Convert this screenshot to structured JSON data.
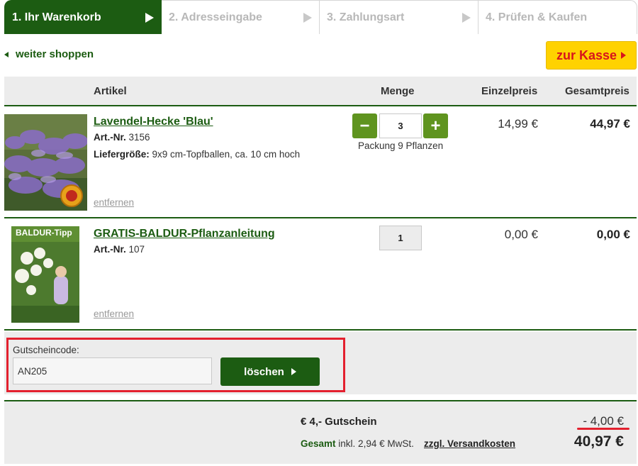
{
  "steps": [
    {
      "label": "1. Ihr Warenkorb"
    },
    {
      "label": "2. Adresseingabe"
    },
    {
      "label": "3. Zahlungsart"
    },
    {
      "label": "4. Prüfen & Kaufen"
    }
  ],
  "nav": {
    "back_label": "weiter shoppen",
    "checkout_label": "zur Kasse"
  },
  "table": {
    "headers": {
      "article": "Artikel",
      "quantity": "Menge",
      "unit_price": "Einzelpreis",
      "total_price": "Gesamtpreis"
    },
    "items": [
      {
        "title": "Lavendel-Hecke 'Blau'",
        "art_label": "Art.-Nr.",
        "art_no": "3156",
        "delivery_label": "Liefergröße:",
        "delivery_value": "9x9 cm-Topfballen, ca. 10 cm hoch",
        "quantity": "3",
        "pack": "Packung 9 Pflanzen",
        "minus": "−",
        "plus": "+",
        "unit_price": "14,99 €",
        "total_price": "44,97 €",
        "remove": "entfernen"
      },
      {
        "title": "GRATIS-BALDUR-Pflanzanleitung",
        "art_label": "Art.-Nr.",
        "art_no": "107",
        "booklet_title": "BALDUR-Tipp",
        "quantity": "1",
        "unit_price": "0,00 €",
        "total_price": "0,00 €",
        "remove": "entfernen"
      }
    ]
  },
  "voucher": {
    "label": "Gutscheincode:",
    "value": "AN205",
    "button_label": "löschen"
  },
  "summary": {
    "discount_label": "€ 4,- Gutschein",
    "discount_value": "- 4,00 €",
    "gesamt_label": "Gesamt",
    "vat_text": "inkl. 2,94 € MwSt.",
    "shipping_link": "zzgl. Versandkosten",
    "grand_total": "40,97 €"
  },
  "colors": {
    "brand_green": "#1c5c12",
    "button_green": "#5f941f",
    "checkout_yellow": "#ffd200",
    "checkout_red": "#d8141c",
    "highlight_red": "#e3202e"
  }
}
